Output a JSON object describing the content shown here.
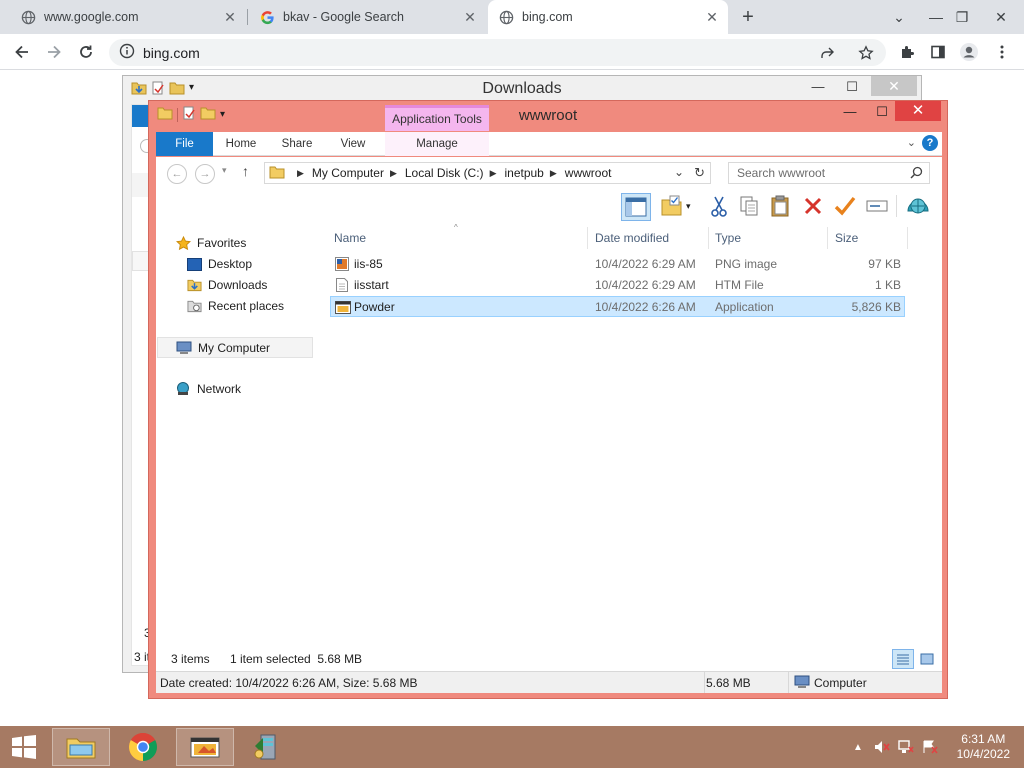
{
  "browser": {
    "tabs": [
      {
        "title": "www.google.com"
      },
      {
        "title": "bkav - Google Search"
      },
      {
        "title": "bing.com"
      }
    ],
    "url": "bing.com"
  },
  "downloads_window": {
    "title": "Downloads",
    "status_count": "3 it",
    "side_count": "3"
  },
  "explorer": {
    "title": "wwwroot",
    "context_tab_group": "Application Tools",
    "ribbon_tabs": [
      "File",
      "Home",
      "Share",
      "View",
      "Manage"
    ],
    "breadcrumb": [
      "My Computer",
      "Local Disk (C:)",
      "inetpub",
      "wwwroot"
    ],
    "search_placeholder": "Search wwwroot",
    "nav": {
      "favorites": "Favorites",
      "desktop": "Desktop",
      "downloads": "Downloads",
      "recent": "Recent places",
      "my_computer": "My Computer",
      "network": "Network"
    },
    "columns": {
      "name": "Name",
      "date": "Date modified",
      "type": "Type",
      "size": "Size"
    },
    "files": [
      {
        "name": "iis-85",
        "date": "10/4/2022 6:29 AM",
        "type": "PNG image",
        "size": "97 KB"
      },
      {
        "name": "iisstart",
        "date": "10/4/2022 6:29 AM",
        "type": "HTM File",
        "size": "1 KB"
      },
      {
        "name": "Powder",
        "date": "10/4/2022 6:26 AM",
        "type": "Application",
        "size": "5,826 KB"
      }
    ],
    "status": {
      "items": "3 items",
      "selected": "1 item selected  5.68 MB"
    },
    "details": {
      "created": "Date created: 10/4/2022 6:26 AM, Size: 5.68 MB",
      "size": "5.68 MB",
      "location": "Computer"
    }
  },
  "taskbar": {
    "time": "6:31 AM",
    "date": "10/4/2022"
  },
  "colors": {
    "explorer_frame": "#f08a7e",
    "taskbar": "#a67a63",
    "file_tab": "#1979ca",
    "selection": "#cce8ff"
  }
}
